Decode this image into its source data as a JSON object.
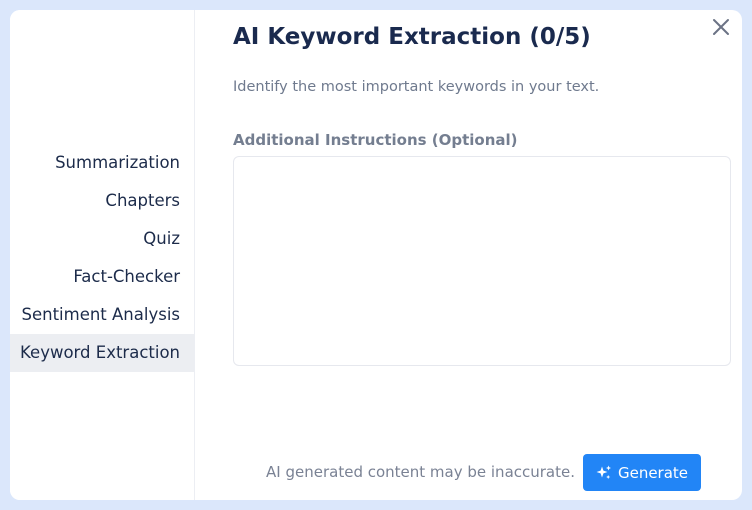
{
  "modal": {
    "title": "AI Keyword Extraction (0/5)",
    "description": "Identify the most important keywords in your text.",
    "instructions_label": "Additional Instructions (Optional)",
    "instructions_value": "",
    "disclaimer": "AI generated content may be inaccurate.",
    "generate_label": "Generate"
  },
  "sidebar": {
    "items": [
      {
        "label": "Summarization",
        "active": false
      },
      {
        "label": "Chapters",
        "active": false
      },
      {
        "label": "Quiz",
        "active": false
      },
      {
        "label": "Fact-Checker",
        "active": false
      },
      {
        "label": "Sentiment Analysis",
        "active": false
      },
      {
        "label": "Keyword Extraction",
        "active": true
      }
    ]
  },
  "icons": {
    "close": "close-icon",
    "generate": "sparkle-icon"
  },
  "colors": {
    "accent": "#2285f6",
    "title": "#1a2a4e",
    "frame": "#dbe7fb",
    "active_item_bg": "#eceef2"
  }
}
